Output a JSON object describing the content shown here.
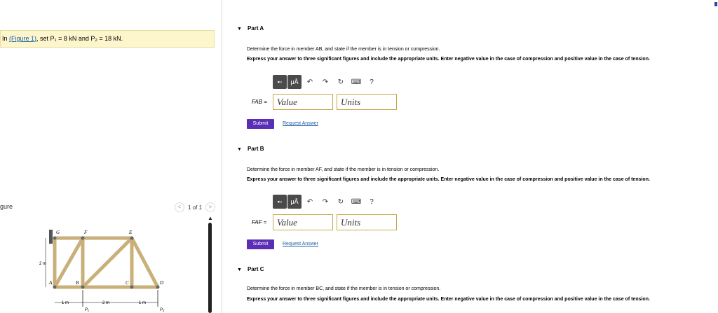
{
  "left": {
    "intro_prefix": "In ",
    "intro_link": "(Figure 1)",
    "intro_text": ", set P₁ = 8 kN and P₂ = 18 kN.",
    "figure_label": "gure",
    "pager": {
      "prev": "<",
      "label": "1 of 1",
      "next": ">"
    },
    "truss": {
      "nodes": [
        "G",
        "F",
        "E",
        "A",
        "B",
        "C",
        "D"
      ],
      "height_label": "2 m",
      "dims": [
        "1 m",
        "2 m",
        "1 m"
      ],
      "loads": [
        "P₁",
        "P₂"
      ]
    }
  },
  "toolbar": {
    "matrix": "▪▫",
    "mu": "μÅ",
    "undo": "↶",
    "redo": "↷",
    "reset": "↻",
    "keyboard": "⌨",
    "help": "?"
  },
  "parts": [
    {
      "title": "Part A",
      "question": "Determine the force in member AB, and state if the member is in tension or compression.",
      "instruction": "Express your answer to three significant figures and include the appropriate units. Enter negative value in the case of compression and positive value in the case of tension.",
      "label": "FAB =",
      "value_placeholder": "Value",
      "units_placeholder": "Units",
      "submit": "Submit",
      "request": "Request Answer"
    },
    {
      "title": "Part B",
      "question": "Determine the force in member AF, and state if the member is in tension or compression.",
      "instruction": "Express your answer to three significant figures and include the appropriate units. Enter negative value in the case of compression and positive value in the case of tension.",
      "label": "FAF =",
      "value_placeholder": "Value",
      "units_placeholder": "Units",
      "submit": "Submit",
      "request": "Request Answer"
    },
    {
      "title": "Part C",
      "question": "Determine the force in member BC, and state if the member is in tension or compression.",
      "instruction": "Express your answer to three significant figures and include the appropriate units. Enter negative value in the case of compression and positive value in the case of tension."
    }
  ],
  "colors": {
    "submit": "#5b2fb5",
    "link": "#1a5ea8",
    "intro_bg": "#fdf6cc",
    "truss_member": "#c9b07a"
  }
}
